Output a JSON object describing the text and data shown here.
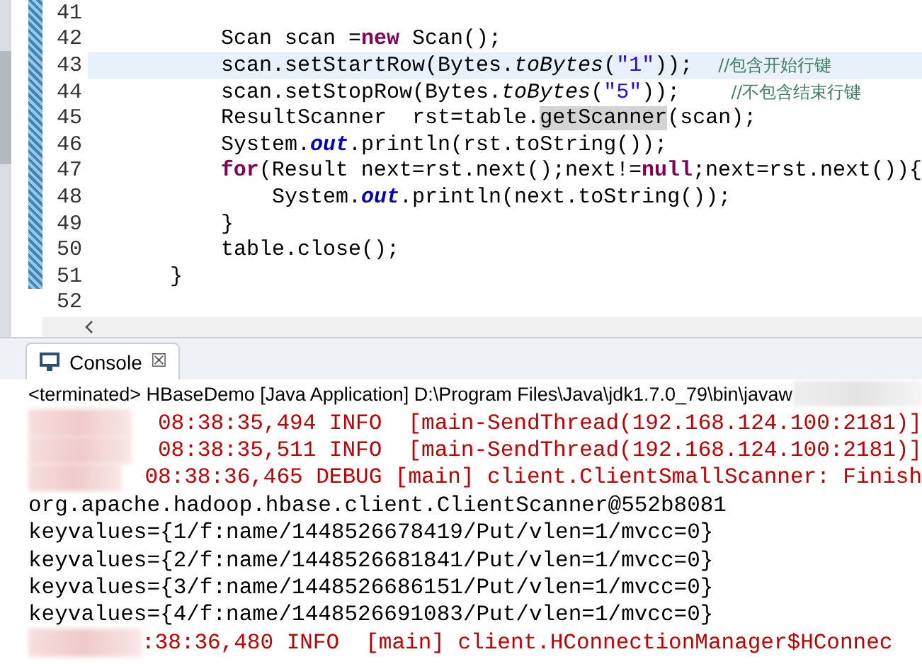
{
  "editor": {
    "lines": [
      {
        "number": "41",
        "current": false
      },
      {
        "number": "42",
        "current": false,
        "segments": [
          {
            "kind": "plain",
            "text": "        Scan scan ="
          },
          {
            "kind": "keyword",
            "text": "new"
          },
          {
            "kind": "plain",
            "text": " Scan();"
          }
        ]
      },
      {
        "number": "43",
        "current": true,
        "segments": [
          {
            "kind": "plain",
            "text": "        scan.setStartRow(Bytes."
          },
          {
            "kind": "italic",
            "text": "toBytes"
          },
          {
            "kind": "plain",
            "text": "("
          },
          {
            "kind": "string",
            "text": "\"1\""
          },
          {
            "kind": "plain",
            "text": "));  "
          },
          {
            "kind": "comment",
            "text": "//包含开始行键"
          }
        ]
      },
      {
        "number": "44",
        "current": false,
        "segments": [
          {
            "kind": "plain",
            "text": "        scan.setStopRow(Bytes."
          },
          {
            "kind": "italic",
            "text": "toBytes"
          },
          {
            "kind": "plain",
            "text": "("
          },
          {
            "kind": "string",
            "text": "\"5\""
          },
          {
            "kind": "plain",
            "text": "));    "
          },
          {
            "kind": "comment",
            "text": "//不包含结束行键"
          }
        ]
      },
      {
        "number": "45",
        "current": false,
        "segments": [
          {
            "kind": "plain",
            "text": "        ResultScanner  rst=table."
          },
          {
            "kind": "occurrence",
            "text": "getScanner"
          },
          {
            "kind": "plain",
            "text": "(scan);"
          }
        ]
      },
      {
        "number": "46",
        "current": false,
        "segments": [
          {
            "kind": "plain",
            "text": "        System."
          },
          {
            "kind": "static",
            "text": "out"
          },
          {
            "kind": "plain",
            "text": ".println(rst.toString());"
          }
        ]
      },
      {
        "number": "47",
        "current": false,
        "segments": [
          {
            "kind": "keyword",
            "text": "        for"
          },
          {
            "kind": "plain",
            "text": "(Result next=rst.next();next!="
          },
          {
            "kind": "keyword",
            "text": "null"
          },
          {
            "kind": "plain",
            "text": ";next=rst.next()){"
          }
        ]
      },
      {
        "number": "48",
        "current": false,
        "segments": [
          {
            "kind": "plain",
            "text": "            System."
          },
          {
            "kind": "static",
            "text": "out"
          },
          {
            "kind": "plain",
            "text": ".println(next.toString());"
          }
        ]
      },
      {
        "number": "49",
        "current": false,
        "segments": [
          {
            "kind": "plain",
            "text": "        }"
          }
        ]
      },
      {
        "number": "50",
        "current": false,
        "segments": [
          {
            "kind": "plain",
            "text": "        table.close();"
          }
        ]
      },
      {
        "number": "51",
        "current": false,
        "segments": [
          {
            "kind": "plain",
            "text": "    }"
          }
        ]
      },
      {
        "number": "52",
        "current": false
      }
    ]
  },
  "console": {
    "tab": {
      "label": "Console",
      "close": "☒",
      "selected": true
    },
    "header": "<terminated> HBaseDemo [Java Application] D:\\Program Files\\Java\\jdk1.7.0_79\\bin\\javaw",
    "lines": [
      {
        "kind": "log",
        "text": "08:38:35,494 INFO  [main-SendThread(192.168.124.100:2181)]"
      },
      {
        "kind": "log",
        "text": "08:38:35,511 INFO  [main-SendThread(192.168.124.100:2181)]"
      },
      {
        "kind": "log",
        "text": "08:38:36,465 DEBUG [main] client.ClientSmallScanner: Finish"
      },
      {
        "kind": "out",
        "text": "org.apache.hadoop.hbase.client.ClientScanner@552b8081"
      },
      {
        "kind": "out",
        "text": "keyvalues={1/f:name/1448526678419/Put/vlen=1/mvcc=0}"
      },
      {
        "kind": "out",
        "text": "keyvalues={2/f:name/1448526681841/Put/vlen=1/mvcc=0}"
      },
      {
        "kind": "out",
        "text": "keyvalues={3/f:name/1448526686151/Put/vlen=1/mvcc=0}"
      },
      {
        "kind": "out",
        "text": "keyvalues={4/f:name/1448526691083/Put/vlen=1/mvcc=0}"
      },
      {
        "kind": "log",
        "text": ":38:36,480 INFO  [main] client.HConnectionManager$HConnec"
      }
    ]
  }
}
